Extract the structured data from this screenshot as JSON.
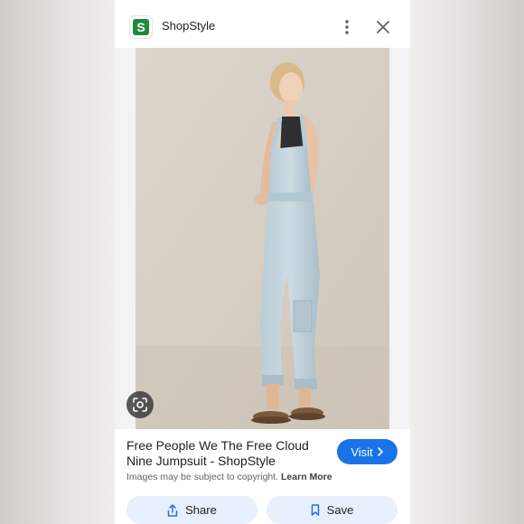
{
  "header": {
    "logo_letter": "S",
    "site_name": "ShopStyle"
  },
  "result": {
    "title": "Free People We The Free Cloud Nine Jumpsuit - ShopStyle",
    "visit_label": "Visit",
    "copyright_text": "Images may be subject to copyright.",
    "learn_more_label": "Learn More"
  },
  "actions": {
    "share_label": "Share",
    "save_label": "Save"
  },
  "colors": {
    "accent": "#1a73e8",
    "button_bg": "#e8f0fe",
    "logo_green": "#1f8a3d"
  },
  "icons": [
    "more-vert-icon",
    "close-icon",
    "lens-search-icon",
    "chevron-right-icon",
    "share-icon",
    "bookmark-icon"
  ]
}
